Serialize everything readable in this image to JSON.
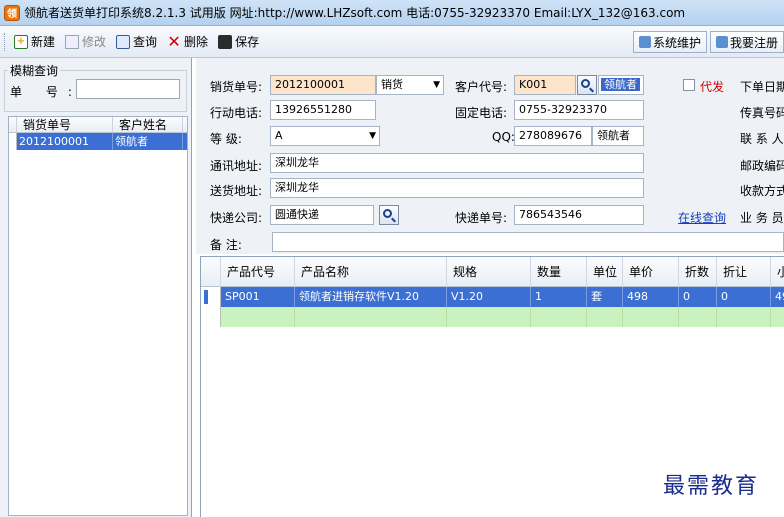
{
  "window": {
    "title": "领航者送货单打印系统8.2.1.3  试用版  网址:http://www.LHZsoft.com  电话:0755-32923370  Email:LYX_132@163.com"
  },
  "toolbar": {
    "new_label": "新建",
    "edit_label": "修改",
    "query_label": "查询",
    "delete_label": "删除",
    "save_label": "保存",
    "maintenance_label": "系统维护",
    "register_label": "我要注册"
  },
  "left_panel": {
    "group_title": "模糊查询",
    "order_no_label": "单   号:",
    "order_no_value": "",
    "columns": [
      "销货单号",
      "客户姓名"
    ],
    "rows": [
      {
        "order_no": "2012100001",
        "customer": "领航者"
      }
    ]
  },
  "form": {
    "sales_no_label": "销货单号:",
    "sales_no_value": "2012100001",
    "sales_type_value": "销货",
    "customer_code_label": "客户代号:",
    "customer_code_value": "K001",
    "customer_name_value": "领航者",
    "proxy_label": "代发",
    "order_date_label": "下单日期",
    "mobile_label": "行动电话:",
    "mobile_value": "13926551280",
    "landline_label": "固定电话:",
    "landline_value": "0755-32923370",
    "fax_label": "传真号码",
    "level_label": "等    级:",
    "level_value": "A",
    "qq_label": "QQ:",
    "qq_value": "278089676",
    "qq_name_value": "领航者",
    "contact_label": "联 系 人",
    "address_label": "通讯地址:",
    "address_value": "深圳龙华",
    "postcode_label": "邮政编码",
    "delivery_address_label": "送货地址:",
    "delivery_address_value": "深圳龙华",
    "payment_label": "收款方式",
    "courier_label": "快递公司:",
    "courier_value": "圆通快递",
    "tracking_label": "快递单号:",
    "tracking_value": "786543546",
    "online_query_label": "在线查询",
    "salesman_label": "业 务 员",
    "remark_label": "备    注:",
    "remark_value": ""
  },
  "products": {
    "columns": [
      "产品代号",
      "产品名称",
      "规格",
      "数量",
      "单位",
      "单价",
      "折数",
      "折让",
      "小"
    ],
    "rows": [
      {
        "code": "SP001",
        "name": "领航者进销存软件V1.20",
        "spec": "V1.20",
        "qty": "1",
        "unit": "套",
        "price": "498",
        "discount_rate": "0",
        "discount": "0",
        "subtotal": "49"
      }
    ]
  },
  "watermark": "最需教育",
  "colors": {
    "selection": "#3b6fd4",
    "new_row": "#c9f2c0",
    "peach_field": "#fde5cc",
    "link": "#1b3fb8",
    "red_label": "#d40000"
  }
}
